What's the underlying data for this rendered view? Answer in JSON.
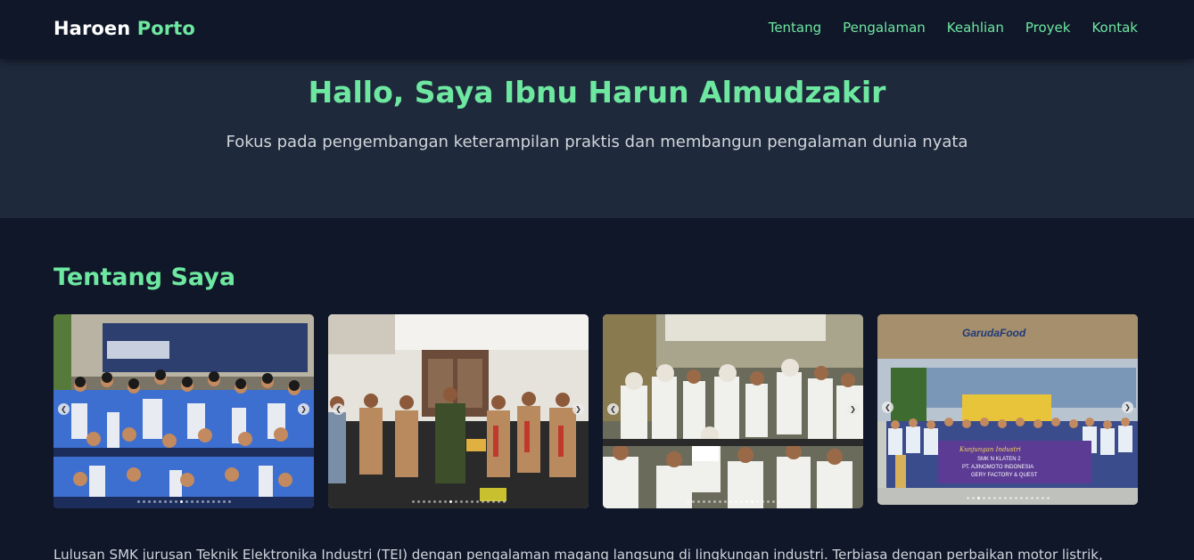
{
  "nav": {
    "brand_main": "Haroen",
    "brand_accent": "Porto",
    "links": [
      "Tentang",
      "Pengalaman",
      "Keahlian",
      "Proyek",
      "Kontak"
    ]
  },
  "hero": {
    "title": "Hallo, Saya Ibnu Harun Almudzakir",
    "subtitle": "Fokus pada pengembangan keterampilan praktis dan membangun pengalaman dunia nyata"
  },
  "about": {
    "title": "Tentang Saya",
    "text": "Lulusan SMK jurusan Teknik Elektronika Industri (TEI) dengan pengalaman magang langsung di lingkungan industri. Terbiasa dengan perbaikan motor listrik,"
  },
  "gallery": {
    "banner_4": {
      "signage": "GarudaFood",
      "line1": "Kunjungan Industri",
      "line2": "SMK N KLATEN 2",
      "line3": "PT. AJINOMOTO INDONESIA",
      "line4": "GERY FACTORY & QUEST"
    }
  },
  "colors": {
    "accent": "#6ee7a0",
    "background": "#0f1729",
    "hero_background": "#1e293b"
  }
}
